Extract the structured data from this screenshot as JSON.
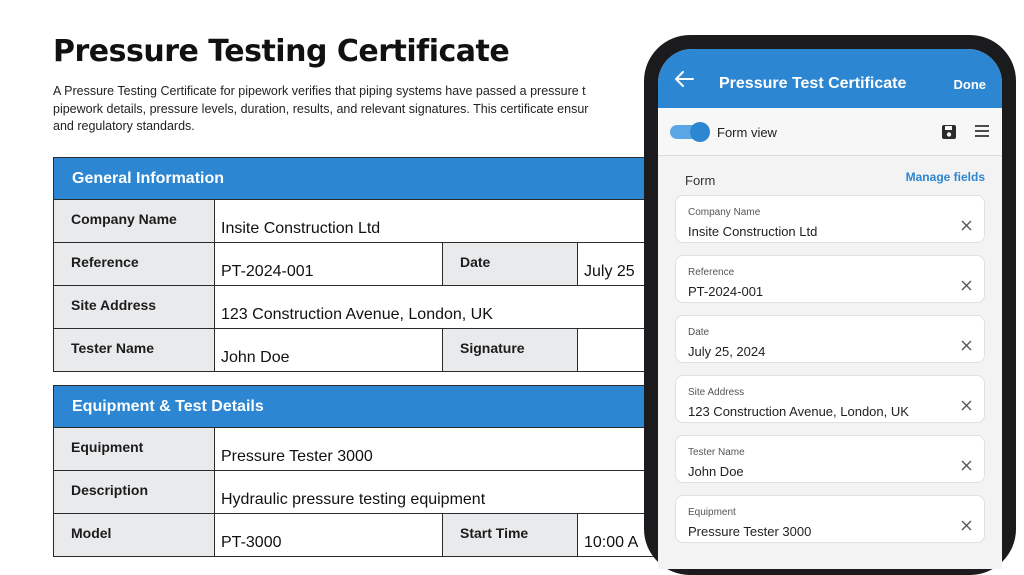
{
  "document": {
    "title": "Pressure Testing Certificate",
    "description": "A Pressure Testing Certificate for pipework verifies that piping systems have passed a pressure t\npipework details, pressure levels, duration, results, and relevant signatures. This certificate ensur\nand regulatory standards.",
    "sections": [
      {
        "header": "General Information",
        "rows": [
          {
            "label": "Company Name",
            "value": "Insite Construction Ltd"
          },
          {
            "label": "Reference",
            "value": "PT-2024-001",
            "label2": "Date",
            "value2": "July 25"
          },
          {
            "label": "Site Address",
            "value": "123 Construction Avenue, London, UK"
          },
          {
            "label": "Tester Name",
            "value": "John Doe",
            "label2": "Signature",
            "value2": ""
          }
        ]
      },
      {
        "header": "Equipment & Test Details",
        "rows": [
          {
            "label": "Equipment",
            "value": "Pressure Tester 3000"
          },
          {
            "label": "Description",
            "value": "Hydraulic pressure testing equipment"
          },
          {
            "label": "Model",
            "value": "PT-3000",
            "label2": "Start Time",
            "value2": "10:00 A"
          }
        ]
      }
    ]
  },
  "app": {
    "title": "Pressure Test Certificate",
    "done_label": "Done",
    "form_view_label": "Form view",
    "form_view_enabled": true,
    "form_label": "Form",
    "manage_fields_label": "Manage fields",
    "accent_color": "#2d86d1",
    "fields": [
      {
        "label": "Company Name",
        "value": "Insite Construction Ltd"
      },
      {
        "label": "Reference",
        "value": "PT-2024-001"
      },
      {
        "label": "Date",
        "value": "July 25, 2024"
      },
      {
        "label": "Site Address",
        "value": " 123 Construction Avenue, London, UK"
      },
      {
        "label": "Tester Name",
        "value": "John Doe"
      },
      {
        "label": "Equipment",
        "value": "Pressure Tester 3000"
      }
    ]
  }
}
